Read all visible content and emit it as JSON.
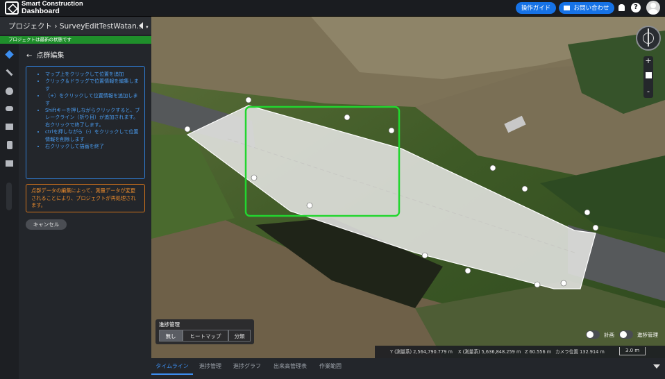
{
  "app": {
    "brand_line1": "Smart Construction",
    "brand_line2": "Dashboard"
  },
  "header": {
    "guide_label": "操作ガイド",
    "contact_label": "お問い合わせ",
    "help_label": "?"
  },
  "project": {
    "breadcrumb": "プロジェクト",
    "separator": "›",
    "name": "SurveyEditTestWatan...",
    "status": "プロジェクトは最新の状態です"
  },
  "panel": {
    "back_label": "点群編集",
    "instructions": [
      "マップ上をクリックして位置を追加",
      "クリック＆ドラッグで位置情報を編集します",
      "（+）をクリックして位置情報を追加します",
      "Shiftキーを押しながらクリックすると、ブレークライン（折り目）が追加されます。右クリックで終了します。",
      "ctrlを押しながら（-）をクリックして位置情報を削除します",
      "右クリックして描画を終了"
    ],
    "warning": "点群データの編集によって、測量データが変更されることにより、プロジェクトが再処理されます。",
    "cancel_label": "キャンセル"
  },
  "progress": {
    "title": "進捗管理",
    "options": [
      "無し",
      "ヒートマップ",
      "分類"
    ],
    "selected": "無し"
  },
  "toggles": {
    "plan_label": "計画",
    "progress_label": "進捗管理"
  },
  "coords": {
    "y": "Y (測量系) 2,564,790.779 m",
    "x": "X (測量系) 5,636,848.259 m",
    "z": "Z 60.556 m",
    "camera": "カメラ位置 132.914 m",
    "scale": "3.0 m"
  },
  "tabs": [
    "タイムライン",
    "進捗管理",
    "進捗グラフ",
    "出来高管理表",
    "作業範囲"
  ],
  "active_tab": "タイムライン",
  "colors": {
    "accent": "#1672e6",
    "status_green": "#1f8f2b",
    "info_blue": "#4a9cf0",
    "warning_orange": "#e88a2c",
    "selection_green": "#22d62f"
  }
}
